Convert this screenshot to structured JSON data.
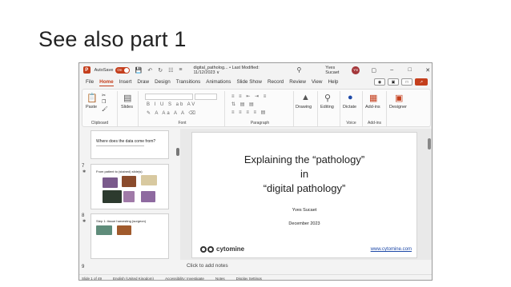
{
  "outer_slide": {
    "title": "See also part 1"
  },
  "titlebar": {
    "app_letter": "P",
    "autosave_label": "AutoSave",
    "autosave_state": "On",
    "filename": "digital_patholog... • Last Modified: 11/12/2023 ∨",
    "user_name": "Yves Sucaet",
    "user_initials": "YS"
  },
  "menu": {
    "items": [
      "File",
      "Home",
      "Insert",
      "Draw",
      "Design",
      "Transitions",
      "Animations",
      "Slide Show",
      "Record",
      "Review",
      "View",
      "Help"
    ],
    "active": "Home"
  },
  "ribbon": {
    "clipboard_label": "Clipboard",
    "paste_label": "Paste",
    "slides_label": "Slides",
    "font_label": "Font",
    "paragraph_label": "Paragraph",
    "drawing_label": "Drawing",
    "editing_label": "Editing",
    "dictate_label": "Dictate",
    "voice_label": "Voice",
    "addins_label": "Add-ins",
    "addins_group_label": "Add-ins",
    "designer_label": "Designer"
  },
  "thumbnails": [
    {
      "number": "",
      "title": "Where does the data come from?"
    },
    {
      "number": "7",
      "title": "From patient to (stained) slide(s)"
    },
    {
      "number": "8",
      "title": "Step 1: tissue harvesting (surgeon)"
    },
    {
      "number": "9",
      "title": ""
    }
  ],
  "main_slide": {
    "line1": "Explaining the “pathology”",
    "line2": "in",
    "line3": "“digital pathology”",
    "author": "Yves Sucaet",
    "date": "December 2023",
    "logo_text": "cytomine",
    "url": "www.cytomine.com"
  },
  "notes_placeholder": "Click to add notes",
  "status": {
    "slide_info": "Slide 1 of 49",
    "language": "English (United Kingdom)",
    "accessibility": "Accessibility: Investigate",
    "notes_btn": "Notes",
    "display_btn": "Display Settings"
  },
  "colors": {
    "accent": "#c43e1c",
    "link": "#1f4aa8"
  }
}
